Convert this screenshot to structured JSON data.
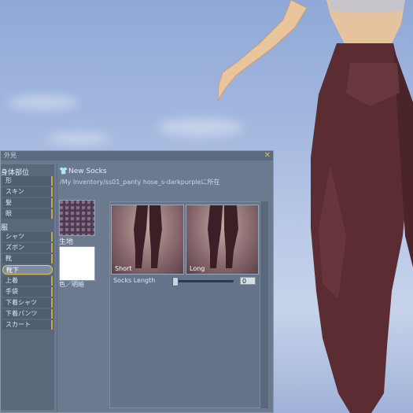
{
  "window": {
    "title": "外見",
    "close_icon": "close-icon",
    "accent": "#f0c040"
  },
  "categories": {
    "body_label": "身体部位",
    "body_items": [
      "形",
      "スキン",
      "髪",
      "眼"
    ],
    "clothes_label": "服",
    "clothes_items": [
      "シャツ",
      "ズボン",
      "靴",
      "靴下",
      "上着",
      "手袋",
      "下着シャツ",
      "下着パンツ",
      "スカート"
    ],
    "selected": "靴下"
  },
  "item": {
    "name": "New Socks",
    "path": "/My Inventory/ss01_panty hose_s-darkpurpleに所在",
    "fabric_label": "生地",
    "color_label": "色／明暗"
  },
  "params": {
    "thumb_short": "Short",
    "thumb_long": "Long",
    "slider_label": "Socks Length",
    "slider_value": "0",
    "slider_level": 0
  }
}
